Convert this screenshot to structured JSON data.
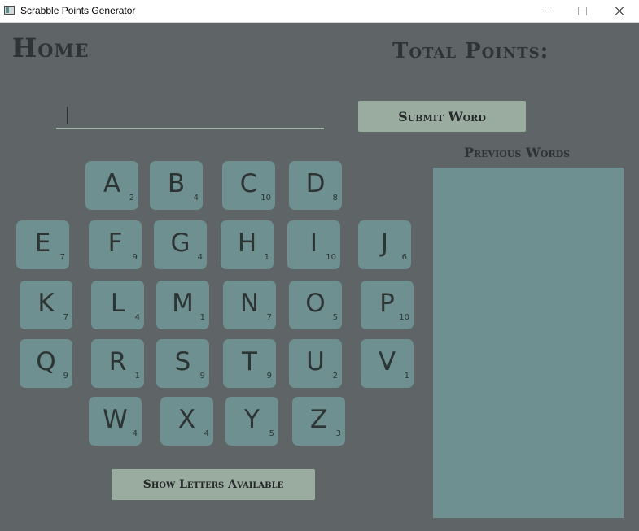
{
  "window": {
    "title": "Scrabble Points Generator"
  },
  "header": {
    "home_label": "Home",
    "total_points_label": "Total Points:"
  },
  "input": {
    "value": ""
  },
  "buttons": {
    "submit_label": "Submit Word",
    "show_letters_label": "Show Letters Available"
  },
  "previous_words": {
    "title": "Previous Words",
    "items": []
  },
  "tiles": [
    {
      "letter": "A",
      "points": "2"
    },
    {
      "letter": "B",
      "points": "4"
    },
    {
      "letter": "C",
      "points": "10"
    },
    {
      "letter": "D",
      "points": "8"
    },
    {
      "letter": "E",
      "points": "7"
    },
    {
      "letter": "F",
      "points": "9"
    },
    {
      "letter": "G",
      "points": "4"
    },
    {
      "letter": "H",
      "points": "1"
    },
    {
      "letter": "I",
      "points": "10"
    },
    {
      "letter": "J",
      "points": "6"
    },
    {
      "letter": "K",
      "points": "7"
    },
    {
      "letter": "L",
      "points": "4"
    },
    {
      "letter": "M",
      "points": "1"
    },
    {
      "letter": "N",
      "points": "7"
    },
    {
      "letter": "O",
      "points": "5"
    },
    {
      "letter": "P",
      "points": "10"
    },
    {
      "letter": "Q",
      "points": "9"
    },
    {
      "letter": "R",
      "points": "1"
    },
    {
      "letter": "S",
      "points": "9"
    },
    {
      "letter": "T",
      "points": "9"
    },
    {
      "letter": "U",
      "points": "2"
    },
    {
      "letter": "V",
      "points": "1"
    },
    {
      "letter": "W",
      "points": "4"
    },
    {
      "letter": "X",
      "points": "4"
    },
    {
      "letter": "Y",
      "points": "5"
    },
    {
      "letter": "Z",
      "points": "3"
    }
  ],
  "colors": {
    "background": "#5f6566",
    "tile": "#6f9090",
    "button": "#9aaca0",
    "text_dark": "#2e3333"
  }
}
